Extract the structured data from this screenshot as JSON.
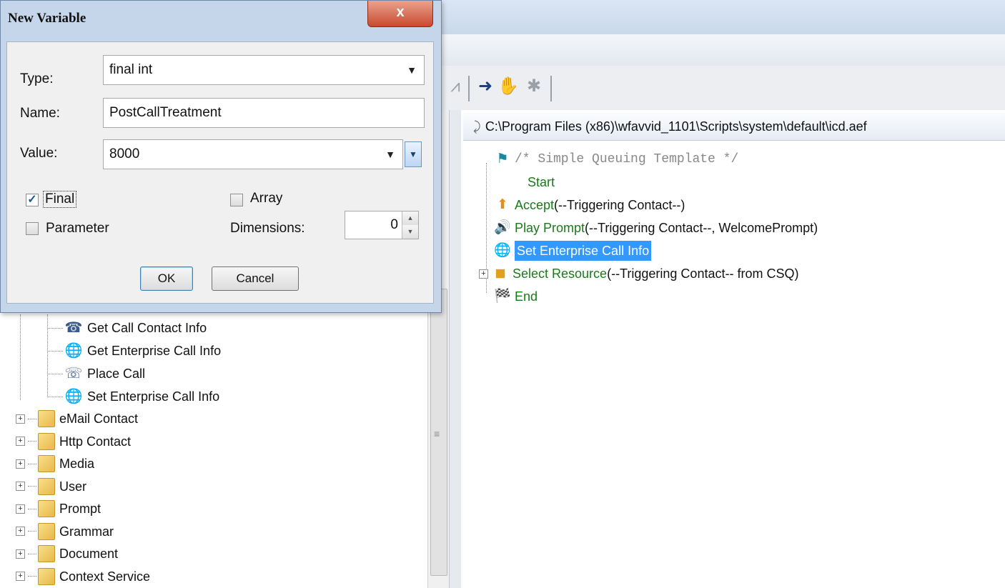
{
  "dialog": {
    "title": "New Variable",
    "close_label": "x",
    "type_label": "Type:",
    "type_value": "final int",
    "name_label": "Name:",
    "name_value": "PostCallTreatment",
    "value_label": "Value:",
    "value_value": "8000",
    "final_label": "Final",
    "final_checked": true,
    "array_label": "Array",
    "array_checked": false,
    "parameter_label": "Parameter",
    "parameter_checked": false,
    "dimensions_label": "Dimensions:",
    "dimensions_value": "0",
    "ok_label": "OK",
    "cancel_label": "Cancel"
  },
  "palette": {
    "call_contact_steps": [
      {
        "label": "Get Call Contact Info",
        "icon": "phone-info-icon"
      },
      {
        "label": "Get Enterprise Call Info",
        "icon": "enterprise-call-icon"
      },
      {
        "label": "Place Call",
        "icon": "place-call-icon"
      },
      {
        "label": "Set Enterprise Call Info",
        "icon": "enterprise-call-icon"
      }
    ],
    "folders": [
      {
        "label": "eMail Contact"
      },
      {
        "label": "Http Contact"
      },
      {
        "label": "Media"
      },
      {
        "label": "User"
      },
      {
        "label": "Prompt"
      },
      {
        "label": "Grammar"
      },
      {
        "label": "Document"
      },
      {
        "label": "Context Service"
      }
    ]
  },
  "script": {
    "path": "C:\\Program Files (x86)\\wfavvid_1101\\Scripts\\system\\default\\icd.aef",
    "steps": [
      {
        "keyword": "/* Simple Queuing Template */",
        "args": "",
        "icon": "flag-icon"
      },
      {
        "keyword": "Start",
        "args": ""
      },
      {
        "keyword": "Accept",
        "args": " (--Triggering Contact--)",
        "icon": "accept-icon"
      },
      {
        "keyword": "Play Prompt",
        "args": " (--Triggering Contact--, WelcomePrompt)",
        "icon": "speaker-icon"
      },
      {
        "keyword": "Set Enterprise Call Info",
        "args": "",
        "icon": "enterprise-call-icon"
      },
      {
        "keyword": "Select Resource",
        "args": " (--Triggering Contact-- from CSQ)",
        "icon": "agent-icon"
      },
      {
        "keyword": "End",
        "args": "",
        "icon": "finish-flag-icon"
      }
    ]
  },
  "colors": {
    "step_keyword": "#1a7a1a",
    "selection": "#3399ff"
  }
}
